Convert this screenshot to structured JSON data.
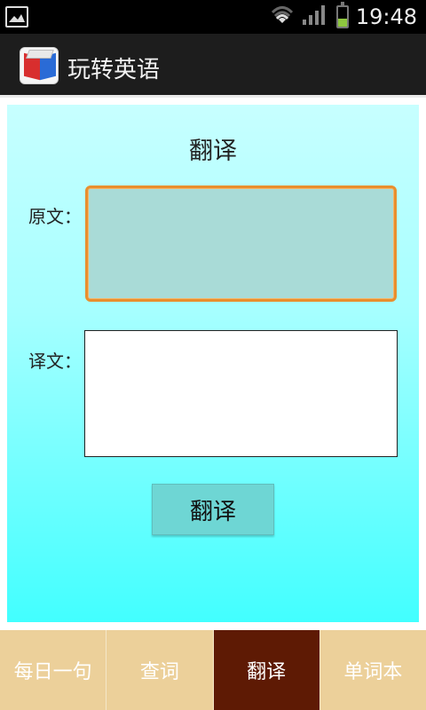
{
  "status_bar": {
    "time": "19:48",
    "icons": [
      "image-icon",
      "wifi-icon",
      "signal-icon",
      "battery-icon"
    ],
    "battery_level": 0.4
  },
  "app_bar": {
    "title": "玩转英语",
    "icon": "app-cube-icon"
  },
  "translate_page": {
    "title": "翻译",
    "source_label": "原文：",
    "target_label": "译文：",
    "source_value": "",
    "target_value": "",
    "button_label": "翻译"
  },
  "bottom_nav": {
    "tabs": [
      {
        "label": "每日一句"
      },
      {
        "label": "查词"
      },
      {
        "label": "翻译"
      },
      {
        "label": "单词本"
      }
    ],
    "active_index": 2
  },
  "colors": {
    "content_gradient_top": "#c7ffff",
    "content_gradient_bottom": "#42ffff",
    "tab_bg": "#ecd09a",
    "tab_active_bg": "#5e1a04",
    "focus_border": "#e88f2f"
  }
}
